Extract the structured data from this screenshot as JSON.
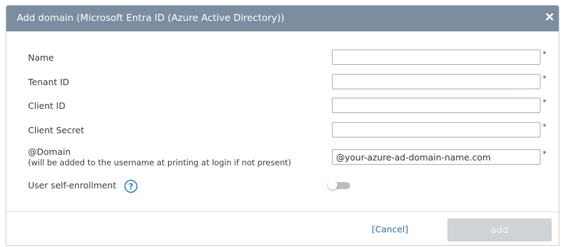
{
  "dialog": {
    "title": "Add domain (Microsoft Entra ID (Azure Active Directory))",
    "close_icon": "close-icon"
  },
  "fields": {
    "name": {
      "label": "Name",
      "value": "",
      "required_mark": "*"
    },
    "tenant_id": {
      "label": "Tenant ID",
      "value": "",
      "required_mark": "*"
    },
    "client_id": {
      "label": "Client ID",
      "value": "",
      "required_mark": "*"
    },
    "client_secret": {
      "label": "Client Secret",
      "value": "",
      "required_mark": "*"
    },
    "domain": {
      "label": "@Domain",
      "hint": "(will be added to the username at printing at login if not present)",
      "value": "@your-azure-ad-domain-name.com",
      "required_mark": "*"
    }
  },
  "self_enrollment": {
    "label": "User self-enrollment",
    "help_icon": "help-icon",
    "enabled": false
  },
  "footer": {
    "cancel_label": "[Cancel]",
    "add_label": "add"
  },
  "colors": {
    "titlebar": "#7c8da0",
    "link": "#2f6db5",
    "help_icon": "#2f80c8",
    "disabled_button": "#d0d3d6"
  }
}
